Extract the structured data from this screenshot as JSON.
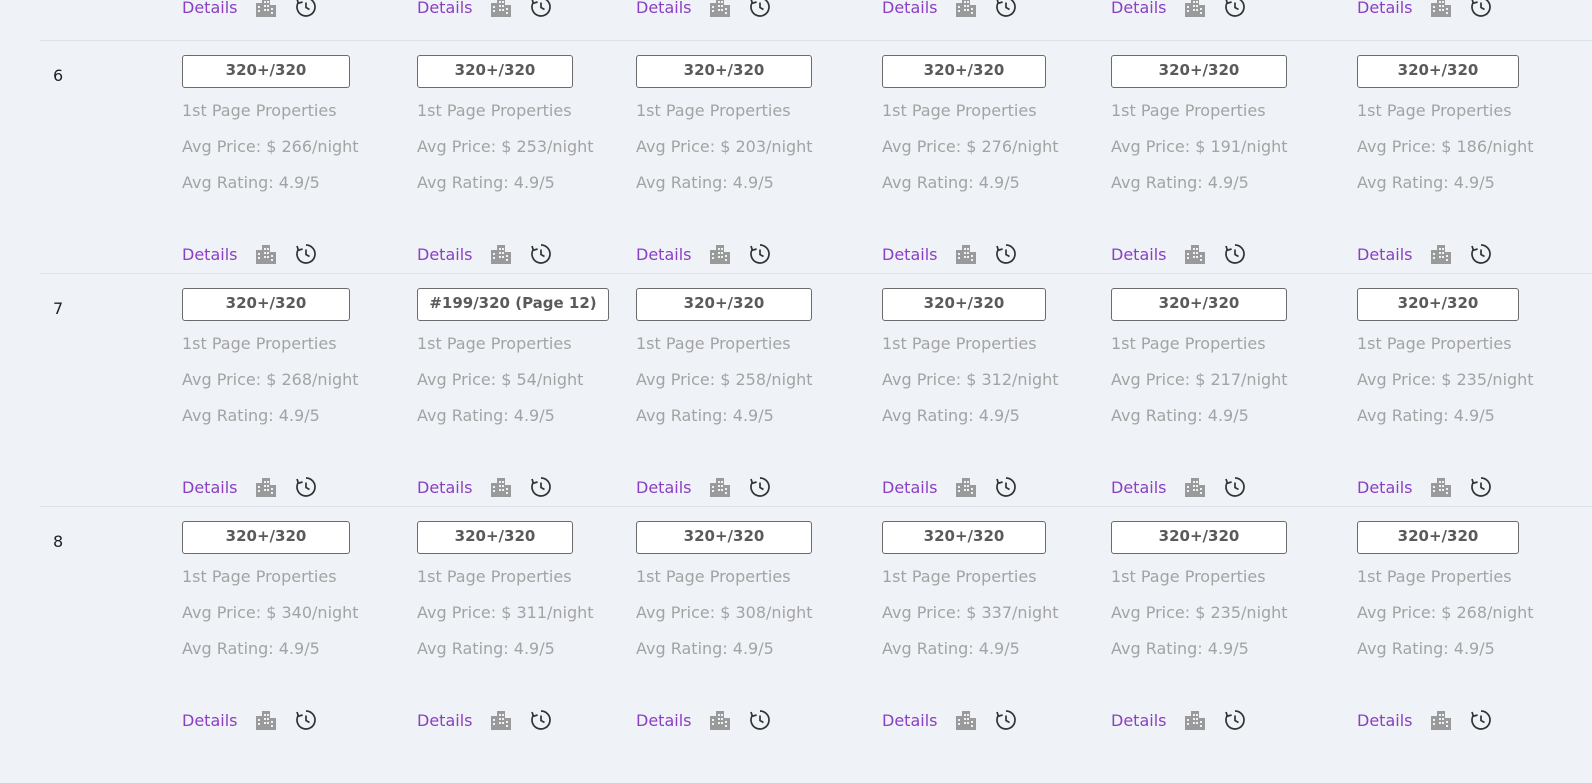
{
  "labels": {
    "details": "Details",
    "first_page": "1st Page Properties"
  },
  "icons": {
    "building": "building-icon",
    "history": "history-clock-icon"
  },
  "colors": {
    "background": "#eff3f7",
    "link": "#8a3fc4",
    "muted_text": "#a3a3a3"
  },
  "rows": [
    {
      "rank": "6",
      "cells": [
        {
          "rank_badge": "320+/320",
          "avg_price": "Avg Price: $ 266/night",
          "avg_rating": "Avg Rating: 4.9/5"
        },
        {
          "rank_badge": "320+/320",
          "avg_price": "Avg Price: $ 253/night",
          "avg_rating": "Avg Rating: 4.9/5"
        },
        {
          "rank_badge": "320+/320",
          "avg_price": "Avg Price: $ 203/night",
          "avg_rating": "Avg Rating: 4.9/5"
        },
        {
          "rank_badge": "320+/320",
          "avg_price": "Avg Price: $ 276/night",
          "avg_rating": "Avg Rating: 4.9/5"
        },
        {
          "rank_badge": "320+/320",
          "avg_price": "Avg Price: $ 191/night",
          "avg_rating": "Avg Rating: 4.9/5"
        },
        {
          "rank_badge": "320+/320",
          "avg_price": "Avg Price: $ 186/night",
          "avg_rating": "Avg Rating: 4.9/5"
        }
      ]
    },
    {
      "rank": "7",
      "cells": [
        {
          "rank_badge": "320+/320",
          "avg_price": "Avg Price: $ 268/night",
          "avg_rating": "Avg Rating: 4.9/5"
        },
        {
          "rank_badge": "#199/320 (Page 12)",
          "avg_price": "Avg Price: $ 54/night",
          "avg_rating": "Avg Rating: 4.9/5"
        },
        {
          "rank_badge": "320+/320",
          "avg_price": "Avg Price: $ 258/night",
          "avg_rating": "Avg Rating: 4.9/5"
        },
        {
          "rank_badge": "320+/320",
          "avg_price": "Avg Price: $ 312/night",
          "avg_rating": "Avg Rating: 4.9/5"
        },
        {
          "rank_badge": "320+/320",
          "avg_price": "Avg Price: $ 217/night",
          "avg_rating": "Avg Rating: 4.9/5"
        },
        {
          "rank_badge": "320+/320",
          "avg_price": "Avg Price: $ 235/night",
          "avg_rating": "Avg Rating: 4.9/5"
        }
      ]
    },
    {
      "rank": "8",
      "cells": [
        {
          "rank_badge": "320+/320",
          "avg_price": "Avg Price: $ 340/night",
          "avg_rating": "Avg Rating: 4.9/5"
        },
        {
          "rank_badge": "320+/320",
          "avg_price": "Avg Price: $ 311/night",
          "avg_rating": "Avg Rating: 4.9/5"
        },
        {
          "rank_badge": "320+/320",
          "avg_price": "Avg Price: $ 308/night",
          "avg_rating": "Avg Rating: 4.9/5"
        },
        {
          "rank_badge": "320+/320",
          "avg_price": "Avg Price: $ 337/night",
          "avg_rating": "Avg Rating: 4.9/5"
        },
        {
          "rank_badge": "320+/320",
          "avg_price": "Avg Price: $ 235/night",
          "avg_rating": "Avg Rating: 4.9/5"
        },
        {
          "rank_badge": "320+/320",
          "avg_price": "Avg Price: $ 268/night",
          "avg_rating": "Avg Rating: 4.9/5"
        }
      ]
    }
  ]
}
